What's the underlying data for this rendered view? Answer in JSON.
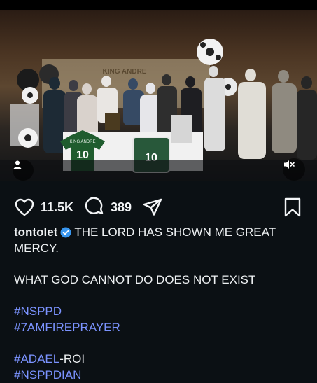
{
  "media": {
    "banner_text": "KING ANDRE",
    "jersey_text": "KING ANDRE",
    "jersey_number": "10",
    "cake_number": "10"
  },
  "actions": {
    "likes": "11.5K",
    "comments": "389"
  },
  "caption": {
    "username": "tontolet",
    "line1": "THE LORD HAS SHOWN ME GREAT MERCY.",
    "line2": "WHAT GOD CANNOT DO DOES NOT EXIST",
    "hashtags": [
      "#NSPPD",
      "#7AMFIREPRAYER"
    ],
    "tag3": "#ADAEL",
    "tag3_suffix": "-ROI",
    "tag4": "#NSPPDIAN"
  },
  "colors": {
    "background": "#0b1014",
    "hashtag": "#7b93ff",
    "verified": "#3897f0"
  }
}
